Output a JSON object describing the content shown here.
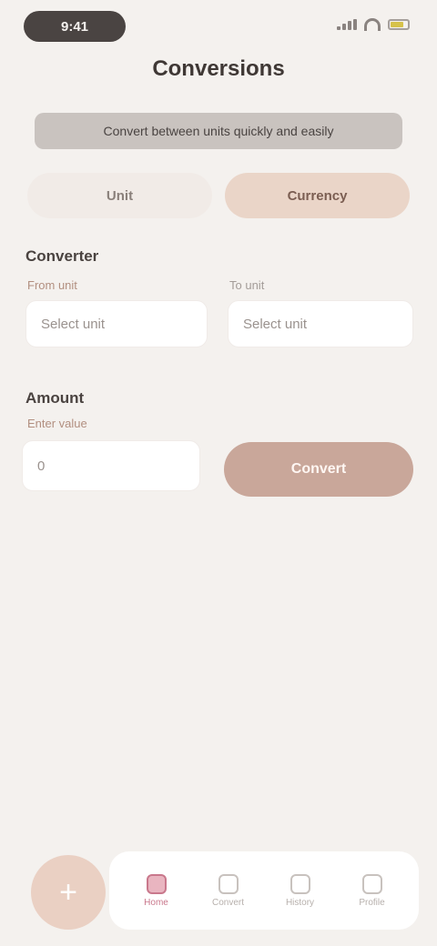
{
  "status": {
    "time": "9:41"
  },
  "page": {
    "title": "Conversions",
    "intro": "Convert between units quickly and easily"
  },
  "tabs": [
    {
      "label": "Unit"
    },
    {
      "label": "Currency"
    }
  ],
  "converter": {
    "section_title": "Converter",
    "from_label": "From unit",
    "to_label": "To unit",
    "from_value": "Select unit",
    "to_value": "Select unit"
  },
  "amount": {
    "section_title": "Amount",
    "label": "Enter value",
    "placeholder": "0",
    "button_label": "Convert"
  },
  "nav": [
    {
      "label": "Home",
      "icon": "home-icon"
    },
    {
      "label": "Convert",
      "icon": "swap-icon"
    },
    {
      "label": "History",
      "icon": "history-icon"
    },
    {
      "label": "Profile",
      "icon": "user-icon"
    }
  ],
  "fab": {
    "label": "+"
  }
}
